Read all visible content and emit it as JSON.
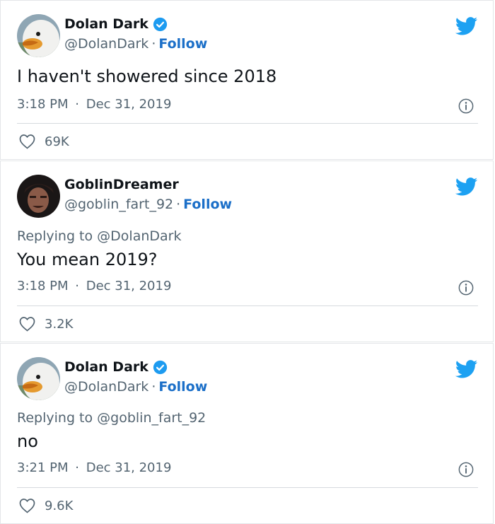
{
  "tweets": [
    {
      "name": "Dolan Dark",
      "verified": true,
      "handle": "@DolanDark",
      "follow": "Follow",
      "reply_prefix": "",
      "reply_handle": "",
      "text": "I haven't showered since 2018",
      "time": "3:18 PM",
      "date": "Dec 31, 2019",
      "likes": "69K"
    },
    {
      "name": "GoblinDreamer",
      "verified": false,
      "handle": "@goblin_fart_92",
      "follow": "Follow",
      "reply_prefix": "Replying to ",
      "reply_handle": "@DolanDark",
      "text": "You mean 2019?",
      "time": "3:18 PM",
      "date": "Dec 31, 2019",
      "likes": "3.2K"
    },
    {
      "name": "Dolan Dark",
      "verified": true,
      "handle": "@DolanDark",
      "follow": "Follow",
      "reply_prefix": "Replying to ",
      "reply_handle": "@goblin_fart_92",
      "text": "no",
      "time": "3:21 PM",
      "date": "Dec 31, 2019",
      "likes": "9.6K"
    }
  ],
  "colors": {
    "brand_blue": "#1da1f2",
    "follow_blue": "#1b6fc8",
    "verified_blue": "#1d9bf0",
    "muted": "#536471"
  },
  "icons": [
    "twitter-bird-icon",
    "verified-badge-icon",
    "info-icon",
    "heart-icon"
  ]
}
